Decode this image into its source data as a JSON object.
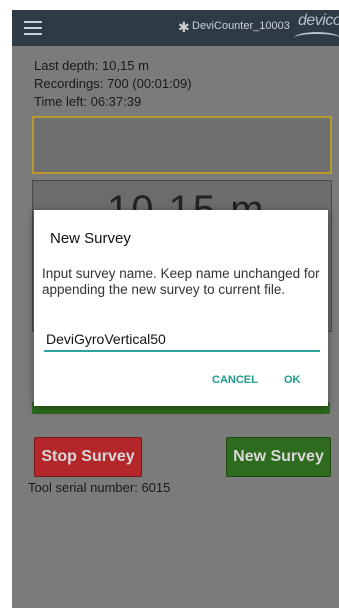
{
  "app_bar": {
    "menu_icon": "hamburger-menu-icon",
    "bluetooth_icon": "bluetooth-icon",
    "device_name": "DeviCounter_10003",
    "logo_text": "devico"
  },
  "status": {
    "last_depth": "Last depth: 10,15 m",
    "recordings": "Recordings: 700 (00:01:09)",
    "time_left": "Time left: 06:37:39"
  },
  "depth_display": {
    "value": "10.15 m"
  },
  "buttons": {
    "stop_survey": "Stop Survey",
    "new_survey": "New Survey"
  },
  "tool": {
    "serial": "Tool serial number: 6015"
  },
  "dialog": {
    "title": "New Survey",
    "message": "Input survey name. Keep name unchanged for appending the new survey to current file.",
    "input_value": "DeviGyroVertical50",
    "cancel_label": "CANCEL",
    "ok_label": "OK"
  },
  "colors": {
    "app_bar": "#2e3b46",
    "stop_button": "#b3262a",
    "new_button": "#2f6b1e",
    "accent": "#1e9a8e"
  }
}
